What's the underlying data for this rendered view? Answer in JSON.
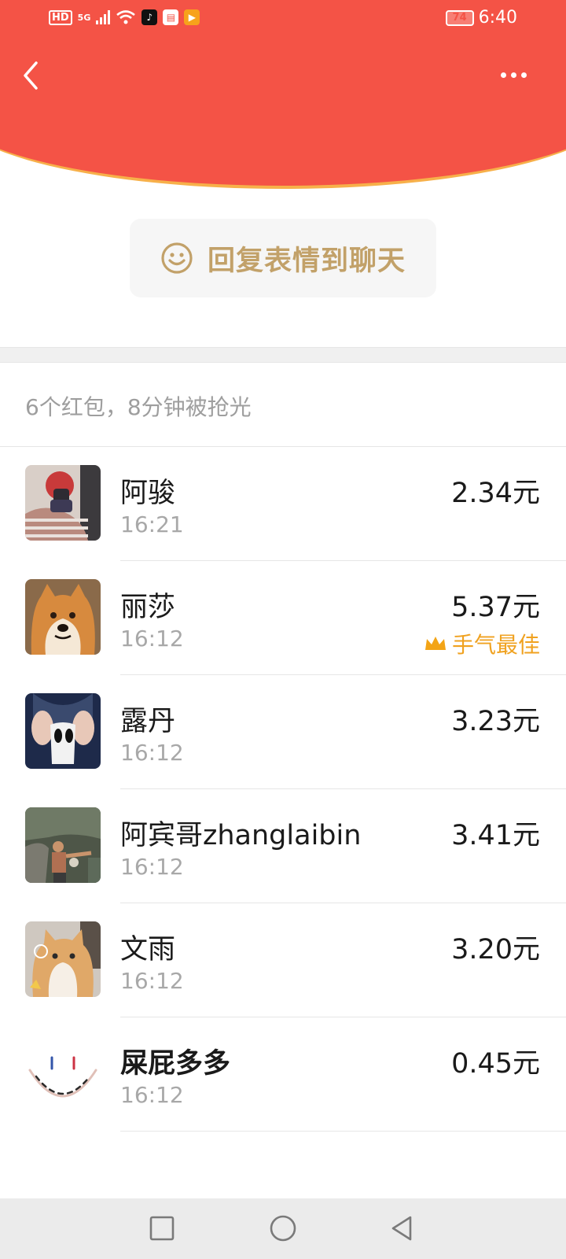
{
  "status_bar": {
    "hd": "HD",
    "network": "5G",
    "battery": "74",
    "time": "6:40"
  },
  "header": {
    "back_icon": "chevron-left-icon",
    "more_icon": "more-dots-icon",
    "bg_color": "#f45346"
  },
  "reply": {
    "label": "回复表情到聊天",
    "icon": "smile-icon",
    "color": "#c2a169"
  },
  "summary": "6个红包，8分钟被抢光",
  "recipients": [
    {
      "name": "阿骏",
      "time": "16:21",
      "amount": "2.34元",
      "best": ""
    },
    {
      "name": "丽莎",
      "time": "16:12",
      "amount": "5.37元",
      "best": "手气最佳"
    },
    {
      "name": "露丹",
      "time": "16:12",
      "amount": "3.23元",
      "best": ""
    },
    {
      "name": "阿宾哥zhanglaibin",
      "time": "16:12",
      "amount": "3.41元",
      "best": ""
    },
    {
      "name": "文雨",
      "time": "16:12",
      "amount": "3.20元",
      "best": ""
    },
    {
      "name": "屎屁多多",
      "time": "16:12",
      "amount": "0.45元",
      "best": ""
    }
  ],
  "nav": [
    "square-icon",
    "circle-icon",
    "triangle-back-icon"
  ]
}
